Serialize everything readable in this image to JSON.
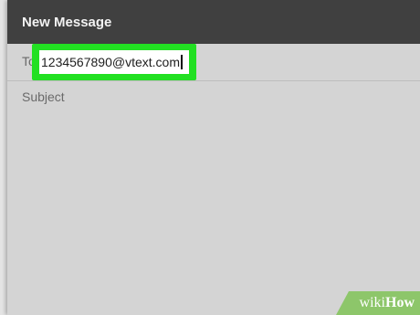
{
  "compose": {
    "title": "New Message",
    "to_label": "To",
    "to_value": "1234567890@vtext.com",
    "subject_placeholder": "Subject"
  },
  "colors": {
    "title_bar": "#404040",
    "highlight": "#22e022",
    "background": "#d4d4d4"
  },
  "watermark": {
    "part1": "wiki",
    "part2": "How"
  }
}
